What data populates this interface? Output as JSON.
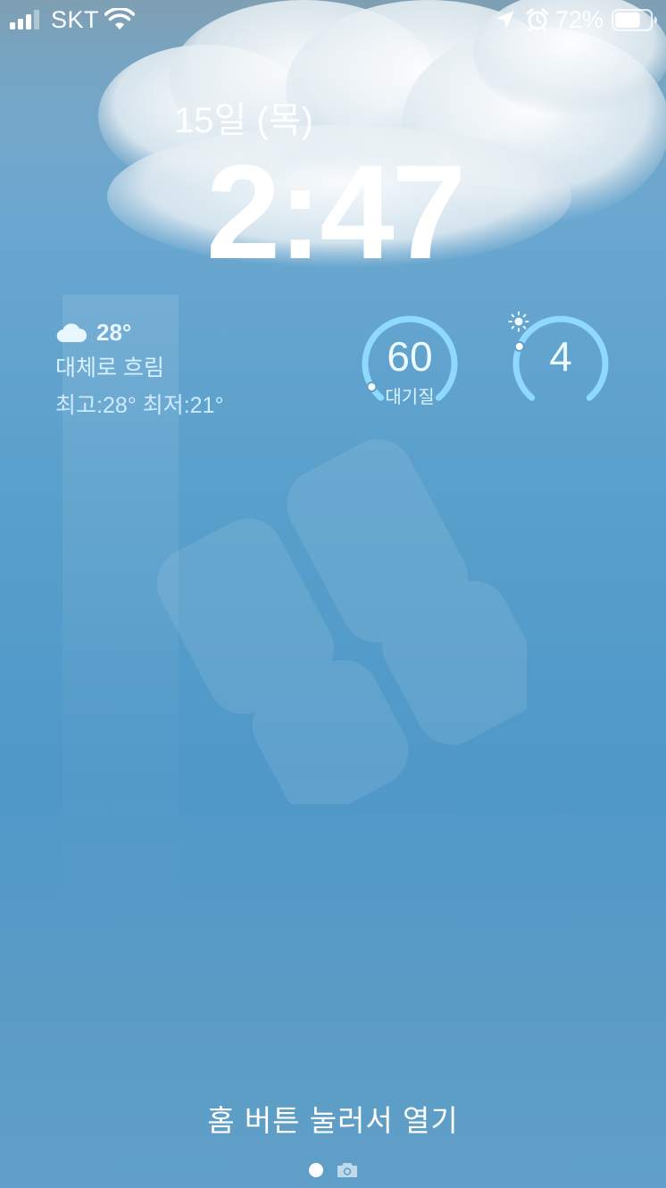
{
  "status_bar": {
    "carrier": "SKT",
    "battery_percent": "72%",
    "battery_level": 0.72,
    "signal_bars": 3,
    "signal_max": 4,
    "icons": [
      "signal-icon",
      "wifi-icon",
      "location-arrow-icon",
      "alarm-icon",
      "battery-icon"
    ]
  },
  "lock_screen": {
    "date": "15일 (목)",
    "time": "2:47"
  },
  "weather": {
    "icon": "cloud-icon",
    "temperature": "28°",
    "condition": "대체로 흐림",
    "high_low": "최고:28° 최저:21°"
  },
  "air_quality": {
    "value": "60",
    "label": "대기질",
    "level": 0.05
  },
  "uv_index": {
    "value": "4",
    "icon": "sun-icon",
    "level": 0.25
  },
  "footer": {
    "unlock_hint": "홈 버튼 눌러서 열기",
    "page_icons": [
      "page-dot",
      "camera-icon"
    ]
  },
  "colors": {
    "accent": "#8fd8ff",
    "gauge_track": "#7ecbf5"
  }
}
